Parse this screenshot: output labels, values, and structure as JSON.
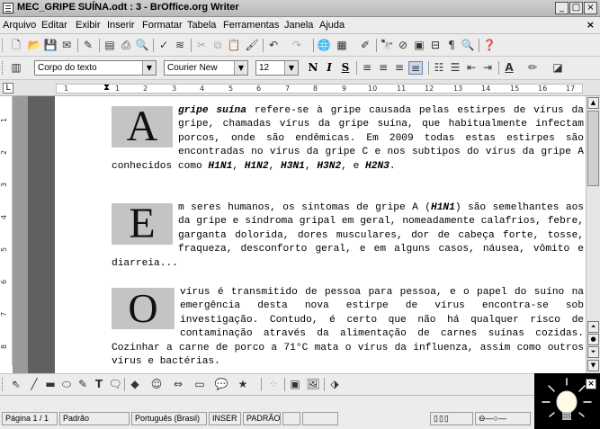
{
  "window": {
    "title": "MEC_GRIPE SUÍNA.odt : 3 - BrOffice.org Writer",
    "minimize": "_",
    "maximize": "□",
    "close": "×"
  },
  "menu": {
    "items": [
      "Arquivo",
      "Editar",
      "Exibir",
      "Inserir",
      "Formatar",
      "Tabela",
      "Ferramentas",
      "Janela",
      "Ajuda"
    ],
    "close": "×"
  },
  "toolbar_format": {
    "style": "Corpo do texto",
    "font": "Courier New",
    "size": "12"
  },
  "ruler": {
    "corner": "L",
    "numbers": [
      "1",
      "1",
      "2",
      "3",
      "4",
      "5",
      "6",
      "7",
      "8",
      "9",
      "10",
      "11",
      "12",
      "13",
      "14",
      "15",
      "16",
      "17"
    ],
    "vnumbers": [
      "1",
      "2",
      "3",
      "4",
      "5",
      "6",
      "7",
      "8"
    ]
  },
  "document": {
    "p1": {
      "cap": "A",
      "lead_bold": "gripe suína",
      "text1": " refere-se à gripe causada pelas estirpes de vírus da gripe, chamadas vírus da gripe suína, que habitualmente infectam porcos, onde são endêmicas. Em 2009 todas estas estirpes são encontradas no vírus da gripe C e nos subtipos do vírus da gripe A conhecidos como ",
      "s1": "H1N1",
      "c1": ", ",
      "s2": "H1N2",
      "c2": ", ",
      "s3": "H3N1",
      "c3": ", ",
      "s4": "H3N2",
      "c4": ", e ",
      "s5": "H2N3",
      "end": "."
    },
    "p2": {
      "cap": "E",
      "text1": "m seres humanos, os sintomas de gripe A (",
      "s1": "H1N1",
      "text2": ") são semelhantes aos da gripe e síndroma gripal em geral, nomeadamente calafrios, febre, garganta dolorida, dores musculares, dor de cabeça forte, tosse, fraqueza, desconforto geral, e em alguns casos, náusea, vômito e diarreia..."
    },
    "p3": {
      "cap": "O",
      "text": " vírus é transmitido de pessoa para pessoa, e o papel do suíno na emergência desta nova estirpe de vírus encontra-se sob investigação. Contudo, é certo que não há qualquer risco de contaminação através da alimentação de carnes suínas cozidas. Cozinhar a carne de porco a 71°C mata o vírus da influenza, assim como outros vírus e bactérias."
    }
  },
  "status": {
    "page": "Página 1 / 1",
    "style": "Padrão",
    "language": "Português (Brasil)",
    "insert": "INSER",
    "selection": "PADRÃO"
  },
  "icons": {
    "toolbar1": [
      "new-icon",
      "open-icon",
      "save-icon",
      "email-icon",
      "edit-icon",
      "export-pdf-icon",
      "print-icon",
      "print-preview-icon",
      "spellcheck-icon",
      "autospell-icon",
      "cut-icon",
      "copy-icon",
      "paste-icon",
      "clone-format-icon",
      "undo-icon",
      "redo-icon",
      "hyperlink-icon",
      "table-icon",
      "show-draw-icon",
      "find-icon",
      "navigator-icon",
      "gallery-icon",
      "datasources-icon",
      "nonprinting-icon",
      "zoom-icon",
      "help-icon"
    ]
  }
}
